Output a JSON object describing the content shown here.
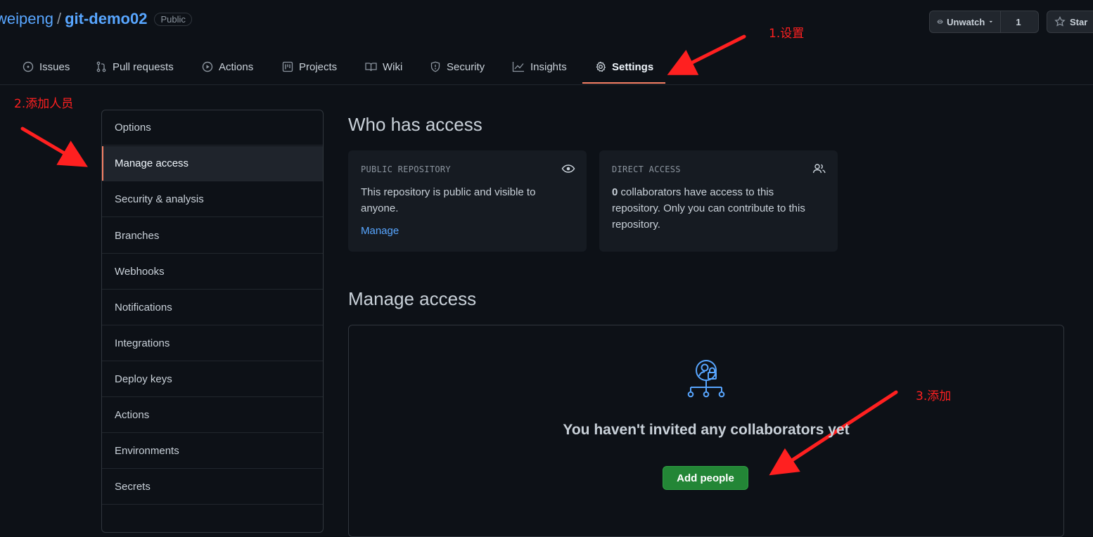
{
  "repo": {
    "owner": "weipeng",
    "separator": "/",
    "name": "git-demo02",
    "visibility": "Public"
  },
  "actions": {
    "unwatch_label": "Unwatch",
    "watch_count": "1",
    "star_label": "Star"
  },
  "tabs": [
    {
      "label": "Issues",
      "icon": "issue-icon"
    },
    {
      "label": "Pull requests",
      "icon": "pull-request-icon"
    },
    {
      "label": "Actions",
      "icon": "play-icon"
    },
    {
      "label": "Projects",
      "icon": "project-icon"
    },
    {
      "label": "Wiki",
      "icon": "book-icon"
    },
    {
      "label": "Security",
      "icon": "shield-icon"
    },
    {
      "label": "Insights",
      "icon": "graph-icon"
    },
    {
      "label": "Settings",
      "icon": "gear-icon",
      "active": true
    }
  ],
  "annotations": {
    "step1": "1.设置",
    "step2": "2.添加人员",
    "step3": "3.添加"
  },
  "sidebar": {
    "items": [
      {
        "label": "Options"
      },
      {
        "label": "Manage access",
        "selected": true
      },
      {
        "label": "Security & analysis"
      },
      {
        "label": "Branches"
      },
      {
        "label": "Webhooks"
      },
      {
        "label": "Notifications"
      },
      {
        "label": "Integrations"
      },
      {
        "label": "Deploy keys"
      },
      {
        "label": "Actions"
      },
      {
        "label": "Environments"
      },
      {
        "label": "Secrets"
      }
    ]
  },
  "who_has_access": {
    "title": "Who has access",
    "public_card": {
      "label": "PUBLIC REPOSITORY",
      "text": "This repository is public and visible to anyone.",
      "link": "Manage",
      "icon": "eye-icon"
    },
    "direct_card": {
      "label": "DIRECT ACCESS",
      "count": "0",
      "text": " collaborators have access to this repository. Only you can contribute to this repository.",
      "icon": "people-icon"
    }
  },
  "manage_access": {
    "title": "Manage access",
    "blank_title": "You haven't invited any collaborators yet",
    "add_button": "Add people",
    "icon": "person-lock-icon"
  },
  "colors": {
    "background": "#0d1117",
    "accent_orange": "#f78166",
    "link_blue": "#58a6ff",
    "button_green": "#238636",
    "annotation_red": "#ff2020"
  }
}
